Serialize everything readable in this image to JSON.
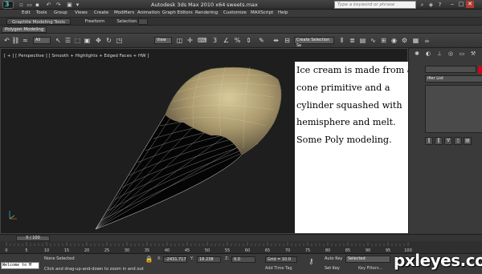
{
  "window": {
    "title": "Autodesk 3ds Max  2010 x64",
    "file": "sweets.max",
    "search_placeholder": "Type a keyword or phrase"
  },
  "menu": [
    "Edit",
    "Tools",
    "Group",
    "Views",
    "Create",
    "Modifiers",
    "Animation",
    "Graph Editors",
    "Rendering",
    "Customize",
    "MAXScript",
    "Help"
  ],
  "ribbon": {
    "tabs": [
      "Graphite Modeling Tools",
      "Freeform",
      "Selection"
    ],
    "sub_tab": "Polygon Modeling"
  },
  "toolbar": {
    "selection_filter": "All",
    "ref_coord": "View",
    "named_selection": "Create Selection Se"
  },
  "viewport": {
    "label": "[ + ] [ Perspective ] [ Smooth + Highlights + Edged Faces + HW ]",
    "overlay_text": "Ice cream is made from a cone primitive and a cylinder squashed with hemisphere and melt. Some Poly modeling."
  },
  "command_panel": {
    "modifier_list": "ifier List",
    "accent_color": "#c20b1c"
  },
  "timeline": {
    "slider_label": "0 / 100",
    "ticks": [
      "0",
      "5",
      "10",
      "15",
      "20",
      "25",
      "30",
      "35",
      "40",
      "45",
      "50",
      "55",
      "60",
      "65",
      "70",
      "75",
      "80",
      "85",
      "90",
      "95",
      "100"
    ]
  },
  "status": {
    "maxscript": "Welcome to M",
    "selection": "None Selected",
    "prompt": "Click and drag-up-and-down to zoom in and out",
    "x_label": "X:",
    "x_value": "-2431.717",
    "y_label": "Y:",
    "y_value": "18.238",
    "z_label": "Z:",
    "z_value": "0.0",
    "grid": "Grid = 10.0",
    "add_time_tag": "Add Time Tag",
    "auto_key": "Auto Key",
    "set_key": "Set Key",
    "key_mode": "Selected",
    "key_filters": "Key Filters..."
  },
  "watermark": "pxleyes.com"
}
